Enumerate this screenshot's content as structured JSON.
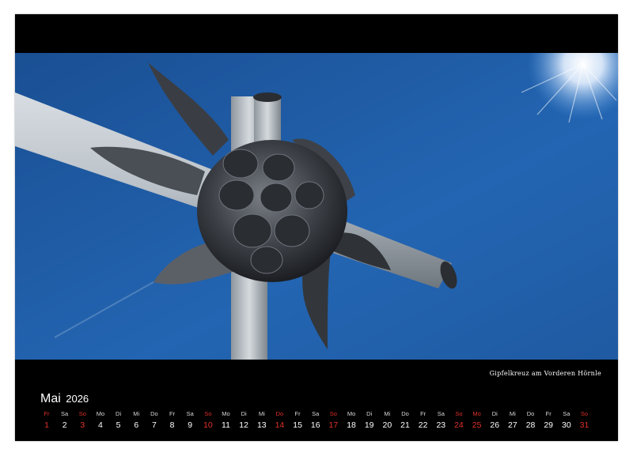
{
  "caption": "Gipfelkreuz am Vorderen Hörnle",
  "calendar": {
    "month": "Mai",
    "year": "2026",
    "days": [
      {
        "wd": "Fr",
        "n": "1",
        "red": true
      },
      {
        "wd": "Sa",
        "n": "2",
        "red": false
      },
      {
        "wd": "So",
        "n": "3",
        "red": true
      },
      {
        "wd": "Mo",
        "n": "4",
        "red": false
      },
      {
        "wd": "Di",
        "n": "5",
        "red": false
      },
      {
        "wd": "Mi",
        "n": "6",
        "red": false
      },
      {
        "wd": "Do",
        "n": "7",
        "red": false
      },
      {
        "wd": "Fr",
        "n": "8",
        "red": false
      },
      {
        "wd": "Sa",
        "n": "9",
        "red": false
      },
      {
        "wd": "So",
        "n": "10",
        "red": true
      },
      {
        "wd": "Mo",
        "n": "11",
        "red": false
      },
      {
        "wd": "Di",
        "n": "12",
        "red": false
      },
      {
        "wd": "Mi",
        "n": "13",
        "red": false
      },
      {
        "wd": "Do",
        "n": "14",
        "red": true
      },
      {
        "wd": "Fr",
        "n": "15",
        "red": false
      },
      {
        "wd": "Sa",
        "n": "16",
        "red": false
      },
      {
        "wd": "So",
        "n": "17",
        "red": true
      },
      {
        "wd": "Mo",
        "n": "18",
        "red": false
      },
      {
        "wd": "Di",
        "n": "19",
        "red": false
      },
      {
        "wd": "Mi",
        "n": "20",
        "red": false
      },
      {
        "wd": "Do",
        "n": "21",
        "red": false
      },
      {
        "wd": "Fr",
        "n": "22",
        "red": false
      },
      {
        "wd": "Sa",
        "n": "23",
        "red": false
      },
      {
        "wd": "So",
        "n": "24",
        "red": true
      },
      {
        "wd": "Mo",
        "n": "25",
        "red": true
      },
      {
        "wd": "Di",
        "n": "26",
        "red": false
      },
      {
        "wd": "Mi",
        "n": "27",
        "red": false
      },
      {
        "wd": "Do",
        "n": "28",
        "red": false
      },
      {
        "wd": "Fr",
        "n": "29",
        "red": false
      },
      {
        "wd": "Sa",
        "n": "30",
        "red": false
      },
      {
        "wd": "So",
        "n": "31",
        "red": true
      }
    ]
  },
  "colors": {
    "page": "#000000",
    "holiday": "#e0302a",
    "sky": "#1f5fa8"
  }
}
